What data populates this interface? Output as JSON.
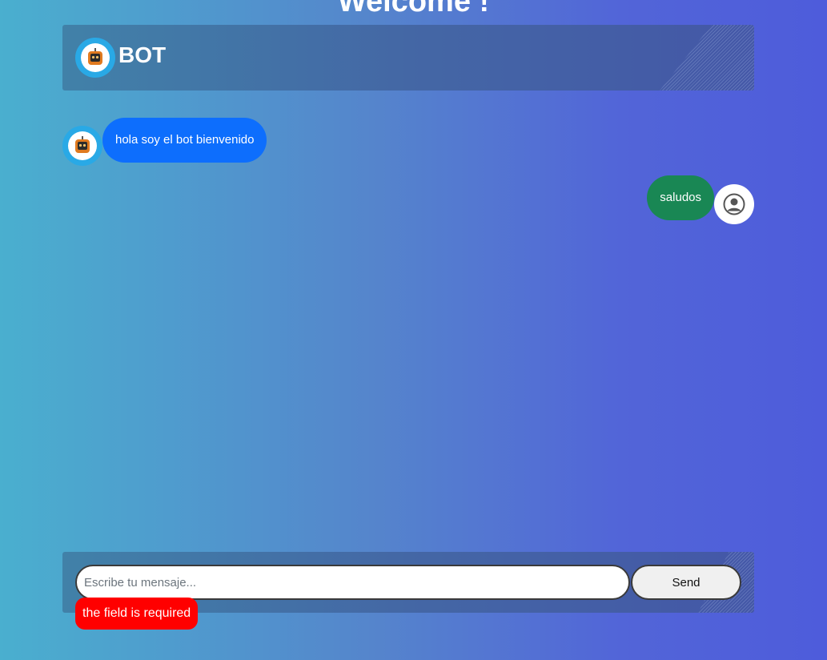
{
  "page": {
    "title": "Welcome !"
  },
  "header": {
    "bot_name": "BOT",
    "avatar_icon": "chatbot-robot-icon"
  },
  "messages": [
    {
      "sender": "bot",
      "text": "hola soy el bot bienvenido",
      "color": "#0d6efd"
    },
    {
      "sender": "user",
      "text": "saludos",
      "color": "#198754"
    }
  ],
  "composer": {
    "placeholder": "Escribe tu mensaje...",
    "value": "",
    "send_label": "Send",
    "error": "the field is required",
    "error_color": "#ff0000"
  }
}
